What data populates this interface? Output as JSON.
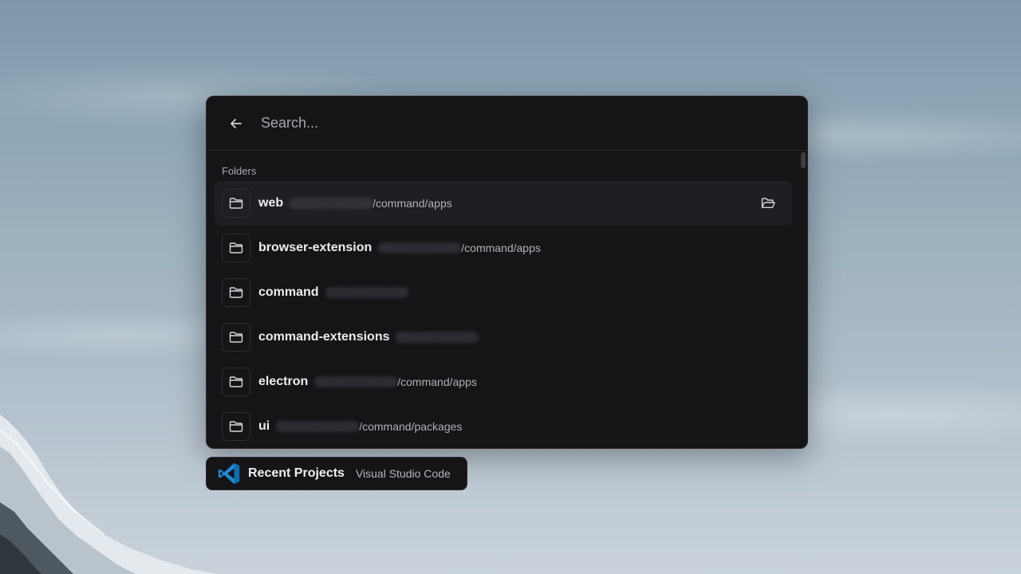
{
  "search": {
    "placeholder": "Search..."
  },
  "section": {
    "heading": "Folders"
  },
  "folders": [
    {
      "name": "web",
      "path_suffix": "/command/apps",
      "has_hidden_prefix": true,
      "selected": true
    },
    {
      "name": "browser-extension",
      "path_suffix": "/command/apps",
      "has_hidden_prefix": true,
      "selected": false
    },
    {
      "name": "command",
      "path_suffix": "",
      "has_hidden_prefix": true,
      "selected": false
    },
    {
      "name": "command-extensions",
      "path_suffix": "",
      "has_hidden_prefix": true,
      "selected": false
    },
    {
      "name": "electron",
      "path_suffix": "/command/apps",
      "has_hidden_prefix": true,
      "selected": false
    },
    {
      "name": "ui",
      "path_suffix": "/command/packages",
      "has_hidden_prefix": true,
      "selected": false
    }
  ],
  "icons": {
    "back": "arrow-left-icon",
    "folder": "folder-icon",
    "open_folder": "folder-open-icon",
    "app": "vscode-icon"
  },
  "footer": {
    "title": "Recent Projects",
    "subtitle": "Visual Studio Code"
  },
  "colors": {
    "panel_bg": "#151518",
    "selected_row_bg": "#1f1f23",
    "vscode_blue": "#1f8ad2"
  }
}
